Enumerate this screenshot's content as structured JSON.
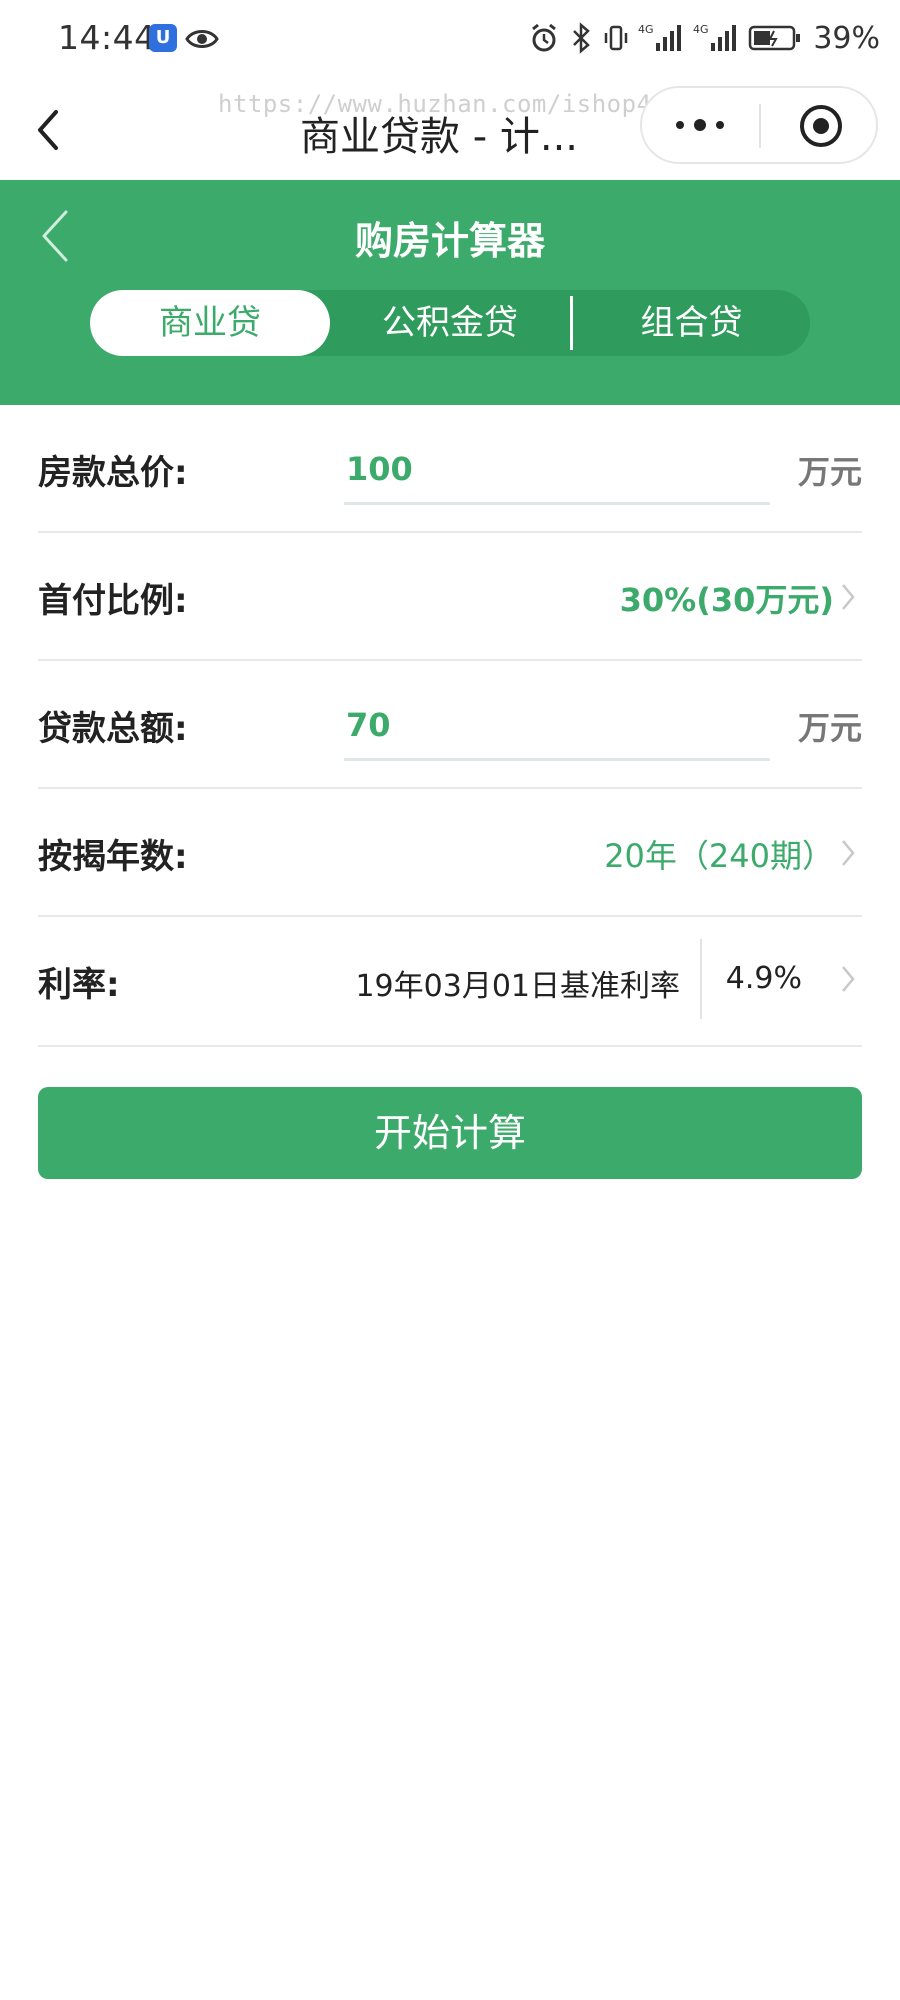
{
  "status_bar": {
    "time": "14:44",
    "shield_glyph": "U",
    "battery_percent": "39%",
    "icons": [
      "alarm-icon",
      "bluetooth-icon",
      "vibrate-icon",
      "signal-4g-icon",
      "signal-4g-icon",
      "battery-icon"
    ]
  },
  "nav": {
    "title": "商业贷款 - 计...",
    "watermark": "https://www.huzhan.com/ishop44453"
  },
  "header": {
    "title": "购房计算器",
    "tabs": [
      {
        "label": "商业贷",
        "active": true
      },
      {
        "label": "公积金贷",
        "active": false
      },
      {
        "label": "组合贷",
        "active": false
      }
    ]
  },
  "form": {
    "house_price": {
      "label": "房款总价:",
      "value": "100",
      "unit": "万元"
    },
    "down_payment": {
      "label": "首付比例:",
      "value": "30%(30万元)"
    },
    "loan_amount": {
      "label": "贷款总额:",
      "value": "70",
      "unit": "万元"
    },
    "loan_years": {
      "label": "按揭年数:",
      "value": "20年（240期）"
    },
    "rate": {
      "label": "利率:",
      "description": "19年03月01日基准利率",
      "value": "4.9%"
    }
  },
  "calculate_button": "开始计算",
  "colors": {
    "accent": "#3caa6a",
    "accent_dark": "#2f9b5c",
    "divider": "#e6eaec"
  }
}
